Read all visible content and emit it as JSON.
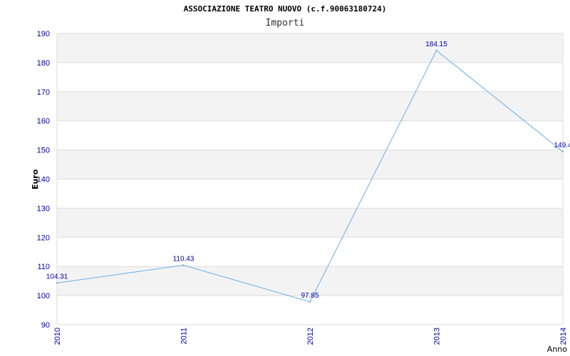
{
  "title": "ASSOCIAZIONE TEATRO NUOVO (c.f.90063180724)",
  "subtitle": "Importi",
  "chart_data": {
    "type": "line",
    "title": "ASSOCIAZIONE TEATRO NUOVO (c.f.90063180724)",
    "subtitle": "Importi",
    "xlabel": "Anno",
    "ylabel": "Euro",
    "categories": [
      "2010",
      "2011",
      "2012",
      "2013",
      "2014"
    ],
    "series": [
      {
        "values": [
          104.31,
          110.43,
          97.85,
          184.15,
          149.4
        ],
        "data_labels": [
          "104.31",
          "110.43",
          "97.85",
          "184.15",
          "149.4"
        ]
      }
    ],
    "ylim": [
      90,
      190
    ],
    "yticks": [
      90,
      100,
      110,
      120,
      130,
      140,
      150,
      160,
      170,
      180,
      190
    ],
    "grid": true,
    "legend": "none",
    "colors": {
      "line": "#6aaee8",
      "tick_text": "#0000aa",
      "band": "#f3f3f3",
      "grid": "#dddddd"
    }
  }
}
